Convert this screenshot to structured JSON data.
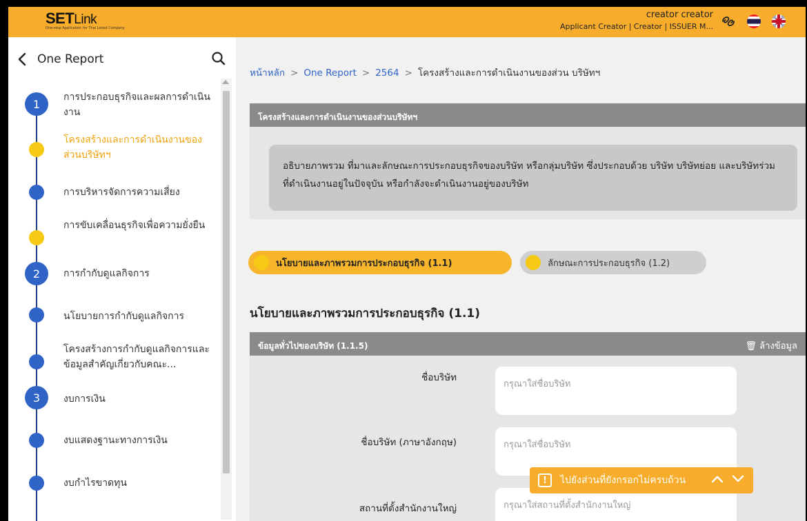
{
  "header": {
    "logo_text_bold": "SET",
    "logo_text_light": "Link",
    "logo_tagline": "One-stop Application for Thai Listed Company",
    "user_name": "creator creator",
    "user_roles": "Applicant Creator | Creator | ISSUER M...",
    "icons": [
      "link-icon",
      "thai-flag-icon",
      "uk-flag-icon"
    ]
  },
  "sidebar": {
    "title": "One Report",
    "items": [
      {
        "marker": "1",
        "label": "การประกอบธุรกิจและผลการดำเนินงาน",
        "state": "section"
      },
      {
        "marker": "",
        "label": "โครงสร้างและการดำเนินงานของส่วนบริษัทฯ",
        "state": "active"
      },
      {
        "marker": "",
        "label": "การบริหารจัดการความเสี่ยง",
        "state": "normal"
      },
      {
        "marker": "",
        "label": "การขับเคลื่อนธุรกิจเพื่อความยั่งยืน",
        "state": "pending"
      },
      {
        "marker": "2",
        "label": "การกำกับดูแลกิจการ",
        "state": "section"
      },
      {
        "marker": "",
        "label": "นโยบายการกำกับดูแลกิจการ",
        "state": "normal"
      },
      {
        "marker": "",
        "label": "โครงสร้างการกำกับดูแลกิจการและข้อมูลสำคัญเกี่ยวกับคณะ...",
        "state": "normal"
      },
      {
        "marker": "3",
        "label": "งบการเงิน",
        "state": "section"
      },
      {
        "marker": "",
        "label": "งบแสดงฐานะทางการเงิน",
        "state": "normal"
      },
      {
        "marker": "",
        "label": "งบกำไรขาดทุน",
        "state": "normal"
      }
    ]
  },
  "breadcrumb": {
    "home": "หน้าหลัก",
    "level1": "One Report",
    "level2": "2564",
    "current": "โครงสร้างและการดำเนินงานของส่วน บริษัทฯ",
    "separator": ">"
  },
  "overview_card": {
    "title": "โครงสร้างและการดำเนินงานของส่วนบริษัทฯ",
    "description": "อธิบายภาพรวม ที่มาและลักษณะการประกอบธุรกิจของบริษัท หรือกลุ่มบริษัท ซึ่งประกอบด้วย บริษัท บริษัทย่อย และบริษัทร่วม ที่ดำเนินงานอยู่ในปัจจุบัน หรือกำลังจะดำเนินงานอยู่ของบริษัท"
  },
  "tabs": [
    {
      "label": "นโยบายและภาพรวมการประกอบธุรกิจ (1.1)",
      "active": true
    },
    {
      "label": "ลักษณะการประกอบธุรกิจ (1.2)",
      "active": false
    }
  ],
  "section_title": "นโยบายและภาพรวมการประกอบธุรกิจ (1.1)",
  "form_card": {
    "title": "ข้อมูลทั่วไปของบริษัท (1.1.5)",
    "clear_label": "ล้างข้อมูล",
    "fields": [
      {
        "label": "ชื่อบริษัท",
        "value": "",
        "placeholder": "กรุณาใส่ชื่อบริษัท"
      },
      {
        "label": "ชื่อบริษัท (ภาษาอังกฤษ)",
        "value": "",
        "placeholder": "กรุณาใส่ชื่อบริษัท"
      },
      {
        "label": "สถานที่ตั้งสำนักงานใหญ่",
        "value": "",
        "placeholder": "กรุณาใส่สถานที่ตั้งสำนักงานใหญ่"
      }
    ]
  },
  "incomplete_nav": {
    "icon": "!",
    "label": "ไปยังส่วนที่ยังกรอกไม่ครบถ้วน"
  },
  "colors": {
    "brand_orange": "#f7ad2b",
    "active_text": "#f0a20b",
    "step_blue": "#2f63c6",
    "step_yellow": "#f6c915",
    "link_blue": "#2f63c6"
  }
}
